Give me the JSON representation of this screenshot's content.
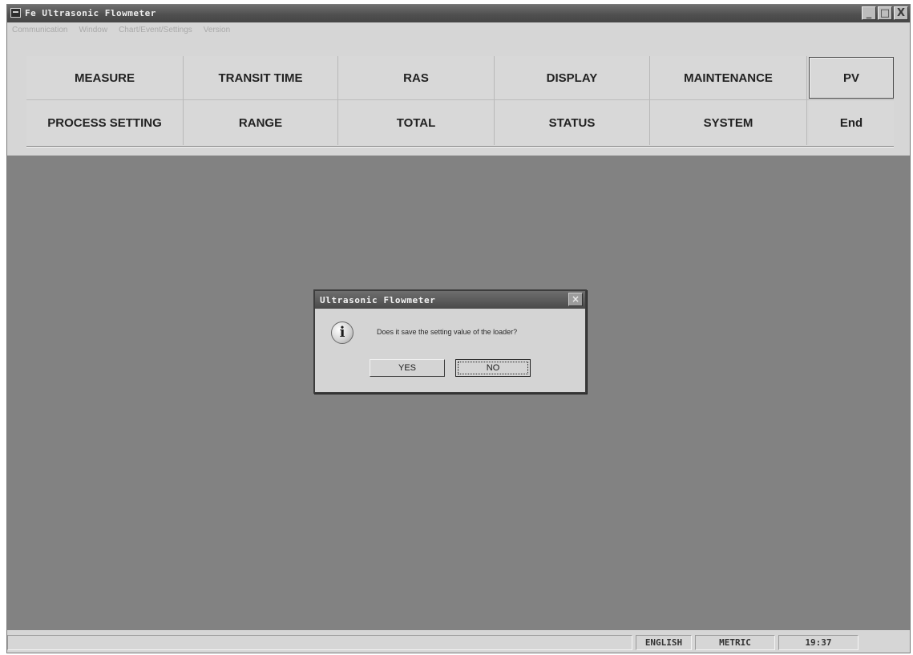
{
  "window": {
    "title": "Fe Ultrasonic Flowmeter",
    "controls": {
      "minimize": "_",
      "maximize": "□",
      "close": "X"
    }
  },
  "menubar": {
    "items": [
      "Communication",
      "Window",
      "Chart/Event/Settings",
      "Version"
    ]
  },
  "menu_buttons": {
    "row1": [
      "MEASURE",
      "TRANSIT TIME",
      "RAS",
      "DISPLAY",
      "MAINTENANCE",
      "PV"
    ],
    "row2": [
      "PROCESS SETTING",
      "RANGE",
      "TOTAL",
      "STATUS",
      "SYSTEM",
      "End"
    ]
  },
  "dialog": {
    "title": "Ultrasonic Flowmeter",
    "close": "×",
    "icon": "info-icon",
    "message": "Does it save the setting value of the loader?",
    "yes": "YES",
    "no": "NO"
  },
  "statusbar": {
    "language": "ENGLISH",
    "units": "METRIC",
    "time": "19:37"
  }
}
